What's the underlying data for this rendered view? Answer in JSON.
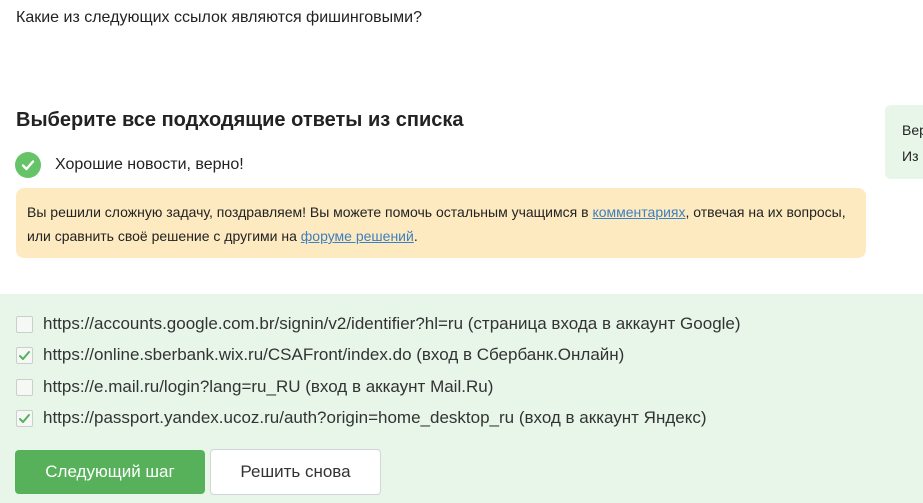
{
  "question": {
    "text": "Какие из следующих ссылок являются фишинговыми?"
  },
  "instruction": "Выберите все подходящие ответы из списка",
  "feedback": {
    "status_text": "Хорошие новости, верно!",
    "status_icon": "check-circle-icon",
    "status_color": "#66c367",
    "hint_before": "Вы решили сложную задачу, поздравляем! Вы можете помочь остальным учащимся в ",
    "comments_link": "комментариях",
    "hint_middle": ", отвечая на их вопросы, или сравнить своё решение с другими на ",
    "forum_link": "форуме решений",
    "hint_after": "."
  },
  "side_panel": {
    "line1": "Вер",
    "line2": "Из"
  },
  "options": [
    {
      "label": "https://accounts.google.com.br/signin/v2/identifier?hl=ru (страница входа в аккаунт Google)",
      "checked": false
    },
    {
      "label": "https://online.sberbank.wix.ru/CSAFront/index.do (вход в Сбербанк.Онлайн)",
      "checked": true
    },
    {
      "label": "https://e.mail.ru/login?lang=ru_RU (вход в аккаунт Mail.Ru)",
      "checked": false
    },
    {
      "label": "https://passport.yandex.ucoz.ru/auth?origin=home_desktop_ru (вход в аккаунт Яндекс)",
      "checked": true
    }
  ],
  "buttons": {
    "next_label": "Следующий шаг",
    "retry_label": "Решить снова"
  },
  "colors": {
    "accent_green": "#56b15a",
    "answers_bg": "#e8f5e9",
    "hint_bg": "#fdeac0",
    "link": "#3d7fbf"
  }
}
